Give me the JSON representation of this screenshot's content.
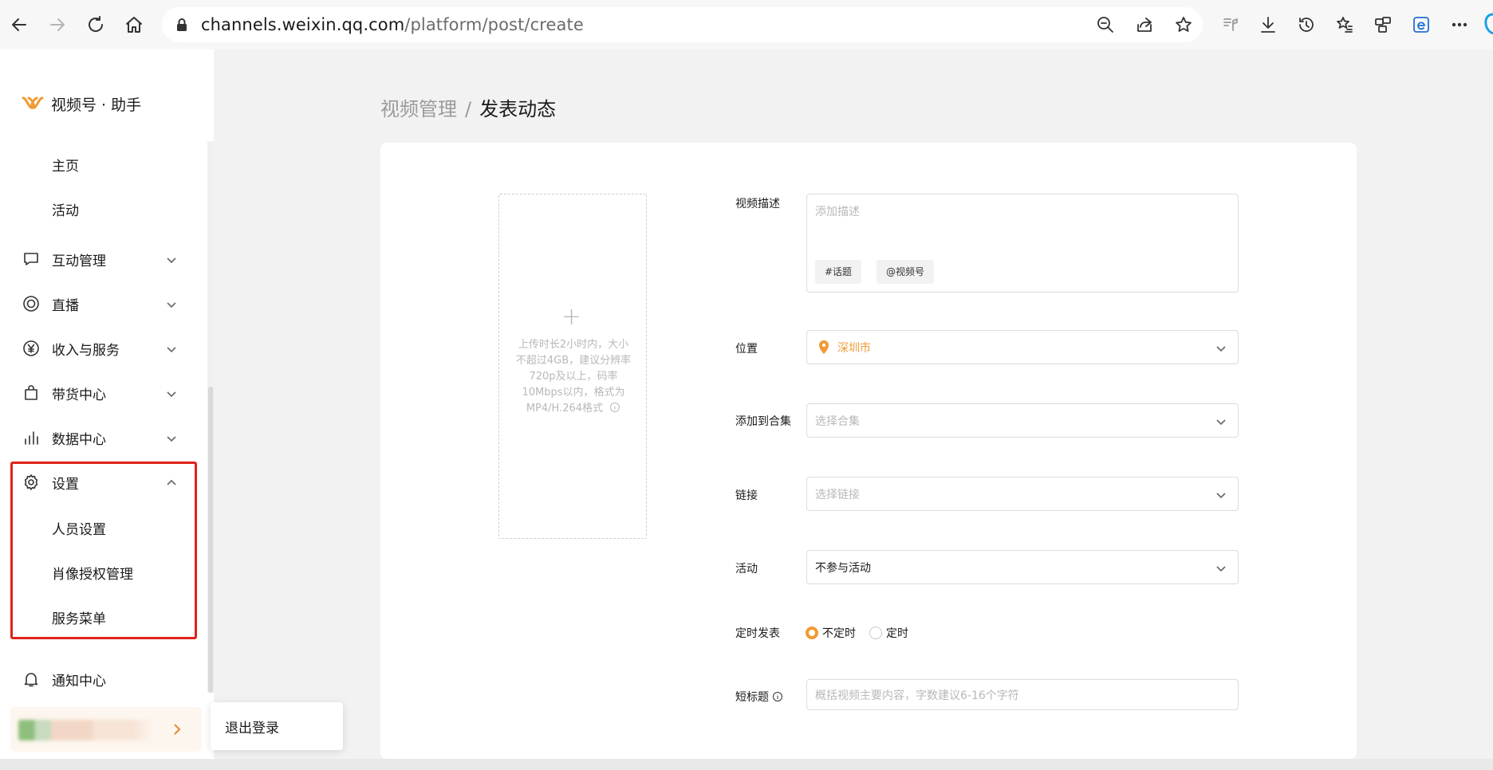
{
  "browser": {
    "url_host": "channels.weixin.qq.com",
    "url_path": "/platform/post/create"
  },
  "sidebar": {
    "logo_text": "视频号 · 助手",
    "items": [
      {
        "label": "主页"
      },
      {
        "label": "活动"
      },
      {
        "label": "互动管理"
      },
      {
        "label": "直播"
      },
      {
        "label": "收入与服务"
      },
      {
        "label": "带货中心"
      },
      {
        "label": "数据中心"
      },
      {
        "label": "设置"
      },
      {
        "label": "人员设置"
      },
      {
        "label": "肖像授权管理"
      },
      {
        "label": "服务菜单"
      },
      {
        "label": "通知中心"
      }
    ],
    "logout_label": "退出登录"
  },
  "main": {
    "breadcrumb_parent": "视频管理",
    "breadcrumb_sep": "/",
    "breadcrumb_current": "发表动态",
    "upload": {
      "plus": "+",
      "hint": "上传时长2小时内，大小不超过4GB，建议分辨率720p及以上，码率10Mbps以内，格式为MP4/H.264格式"
    },
    "form": {
      "desc_label": "视频描述",
      "desc_placeholder": "添加描述",
      "topic_tag": "#话题",
      "channel_tag": "@视频号",
      "location_label": "位置",
      "location_value": "深圳市",
      "collection_label": "添加到合集",
      "collection_placeholder": "选择合集",
      "link_label": "链接",
      "link_placeholder": "选择链接",
      "activity_label": "活动",
      "activity_value": "不参与活动",
      "schedule_label": "定时发表",
      "schedule_options": [
        "不定时",
        "定时"
      ],
      "short_title_label": "短标题",
      "short_title_placeholder": "概括视频主要内容，字数建议6-16个字符"
    }
  },
  "colors": {
    "accent": "#f09a34",
    "highlight": "#e0221c"
  }
}
